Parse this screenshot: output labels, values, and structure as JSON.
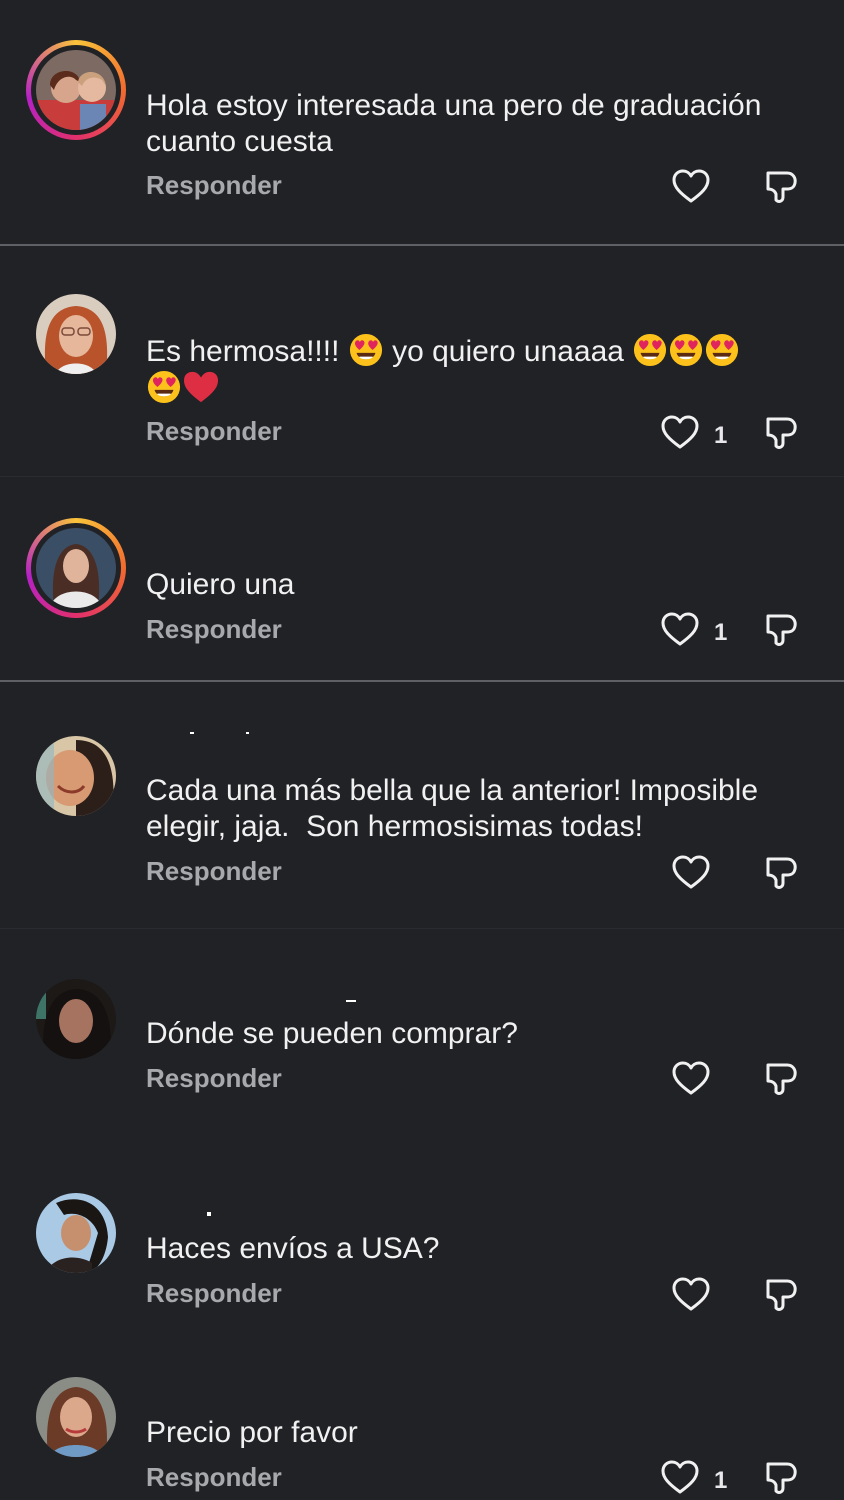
{
  "reply_label": "Responder",
  "comments": [
    {
      "text": "Hola estoy interesada una pero de graduación cuanto cuesta",
      "likes": "",
      "has_story": true
    },
    {
      "text_1": "Es hermosa!!!! ",
      "text_2": " yo quiero unaaaa ",
      "likes": "1",
      "has_story": false
    },
    {
      "text": "Quiero una",
      "likes": "1",
      "has_story": true
    },
    {
      "text": "Cada una más bella que la anterior! Imposible elegir, jaja.  Son hermosisimas todas!",
      "likes": "",
      "has_story": false
    },
    {
      "text": "Dónde se pueden comprar?",
      "likes": "",
      "has_story": false
    },
    {
      "text": "Haces envíos a USA?",
      "likes": "",
      "has_story": false
    },
    {
      "text": "Precio por favor",
      "likes": "1",
      "has_story": false
    }
  ],
  "icons": {
    "like": "heart-outline-icon",
    "dislike": "thumbs-down-outline-icon",
    "emoji_love": "heart-eyes-emoji",
    "emoji_heart": "red-heart-emoji"
  },
  "colors": {
    "background": "#212226",
    "text": "#f1f1f2",
    "secondary": "#a8a9ad",
    "story_ring_start": "#f9c33a",
    "story_ring_end": "#b620c6"
  }
}
